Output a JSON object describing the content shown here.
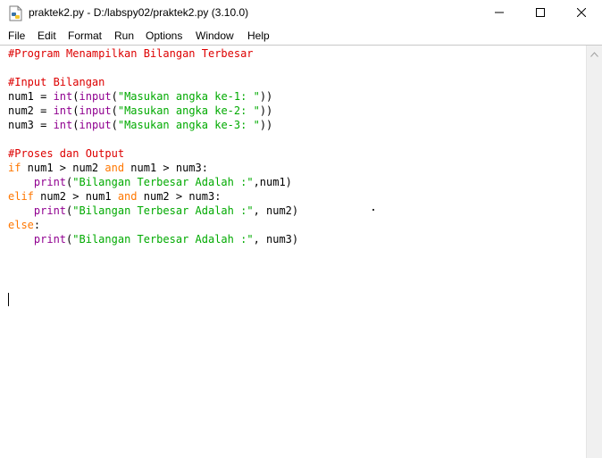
{
  "window": {
    "title": "praktek2.py - D:/labspy02/praktek2.py (3.10.0)"
  },
  "menu": [
    {
      "label": "File"
    },
    {
      "label": "Edit"
    },
    {
      "label": "Format"
    },
    {
      "label": "Run"
    },
    {
      "label": "Options"
    },
    {
      "label": "Window"
    },
    {
      "label": "Help"
    }
  ],
  "icons": {
    "app": "python-file-icon",
    "minimize": "minimize-icon",
    "maximize": "maximize-icon",
    "close": "close-icon",
    "scroll_up": "chevron-up-icon"
  },
  "colors": {
    "comment": "#dd0000",
    "keyword": "#ff7700",
    "builtin": "#900090",
    "string": "#00aa00"
  },
  "code_lines": [
    [
      {
        "t": "#Program Menampilkan Bilangan Terbesar",
        "c": "comment"
      }
    ],
    [],
    [
      {
        "t": "#Input Bilangan",
        "c": "comment"
      }
    ],
    [
      {
        "t": "num1 = "
      },
      {
        "t": "int",
        "c": "builtin"
      },
      {
        "t": "("
      },
      {
        "t": "input",
        "c": "builtin"
      },
      {
        "t": "("
      },
      {
        "t": "\"Masukan angka ke-1: \"",
        "c": "string"
      },
      {
        "t": "))"
      }
    ],
    [
      {
        "t": "num2 = "
      },
      {
        "t": "int",
        "c": "builtin"
      },
      {
        "t": "("
      },
      {
        "t": "input",
        "c": "builtin"
      },
      {
        "t": "("
      },
      {
        "t": "\"Masukan angka ke-2: \"",
        "c": "string"
      },
      {
        "t": "))"
      }
    ],
    [
      {
        "t": "num3 = "
      },
      {
        "t": "int",
        "c": "builtin"
      },
      {
        "t": "("
      },
      {
        "t": "input",
        "c": "builtin"
      },
      {
        "t": "("
      },
      {
        "t": "\"Masukan angka ke-3: \"",
        "c": "string"
      },
      {
        "t": "))"
      }
    ],
    [],
    [
      {
        "t": "#Proses dan Output",
        "c": "comment"
      }
    ],
    [
      {
        "t": "if",
        "c": "kw"
      },
      {
        "t": " num1 > num2 "
      },
      {
        "t": "and",
        "c": "kw"
      },
      {
        "t": " num1 > num3:"
      }
    ],
    [
      {
        "t": "    "
      },
      {
        "t": "print",
        "c": "builtin"
      },
      {
        "t": "("
      },
      {
        "t": "\"Bilangan Terbesar Adalah :\"",
        "c": "string"
      },
      {
        "t": ",num1)"
      }
    ],
    [
      {
        "t": "elif",
        "c": "kw"
      },
      {
        "t": " num2 > num1 "
      },
      {
        "t": "and",
        "c": "kw"
      },
      {
        "t": " num2 > num3:"
      }
    ],
    [
      {
        "t": "    "
      },
      {
        "t": "print",
        "c": "builtin"
      },
      {
        "t": "("
      },
      {
        "t": "\"Bilangan Terbesar Adalah :\"",
        "c": "string"
      },
      {
        "t": ", num2)"
      }
    ],
    [
      {
        "t": "else",
        "c": "kw"
      },
      {
        "t": ":"
      }
    ],
    [
      {
        "t": "    "
      },
      {
        "t": "print",
        "c": "builtin"
      },
      {
        "t": "("
      },
      {
        "t": "\"Bilangan Terbesar Adalah :\"",
        "c": "string"
      },
      {
        "t": ", num3)"
      }
    ]
  ]
}
